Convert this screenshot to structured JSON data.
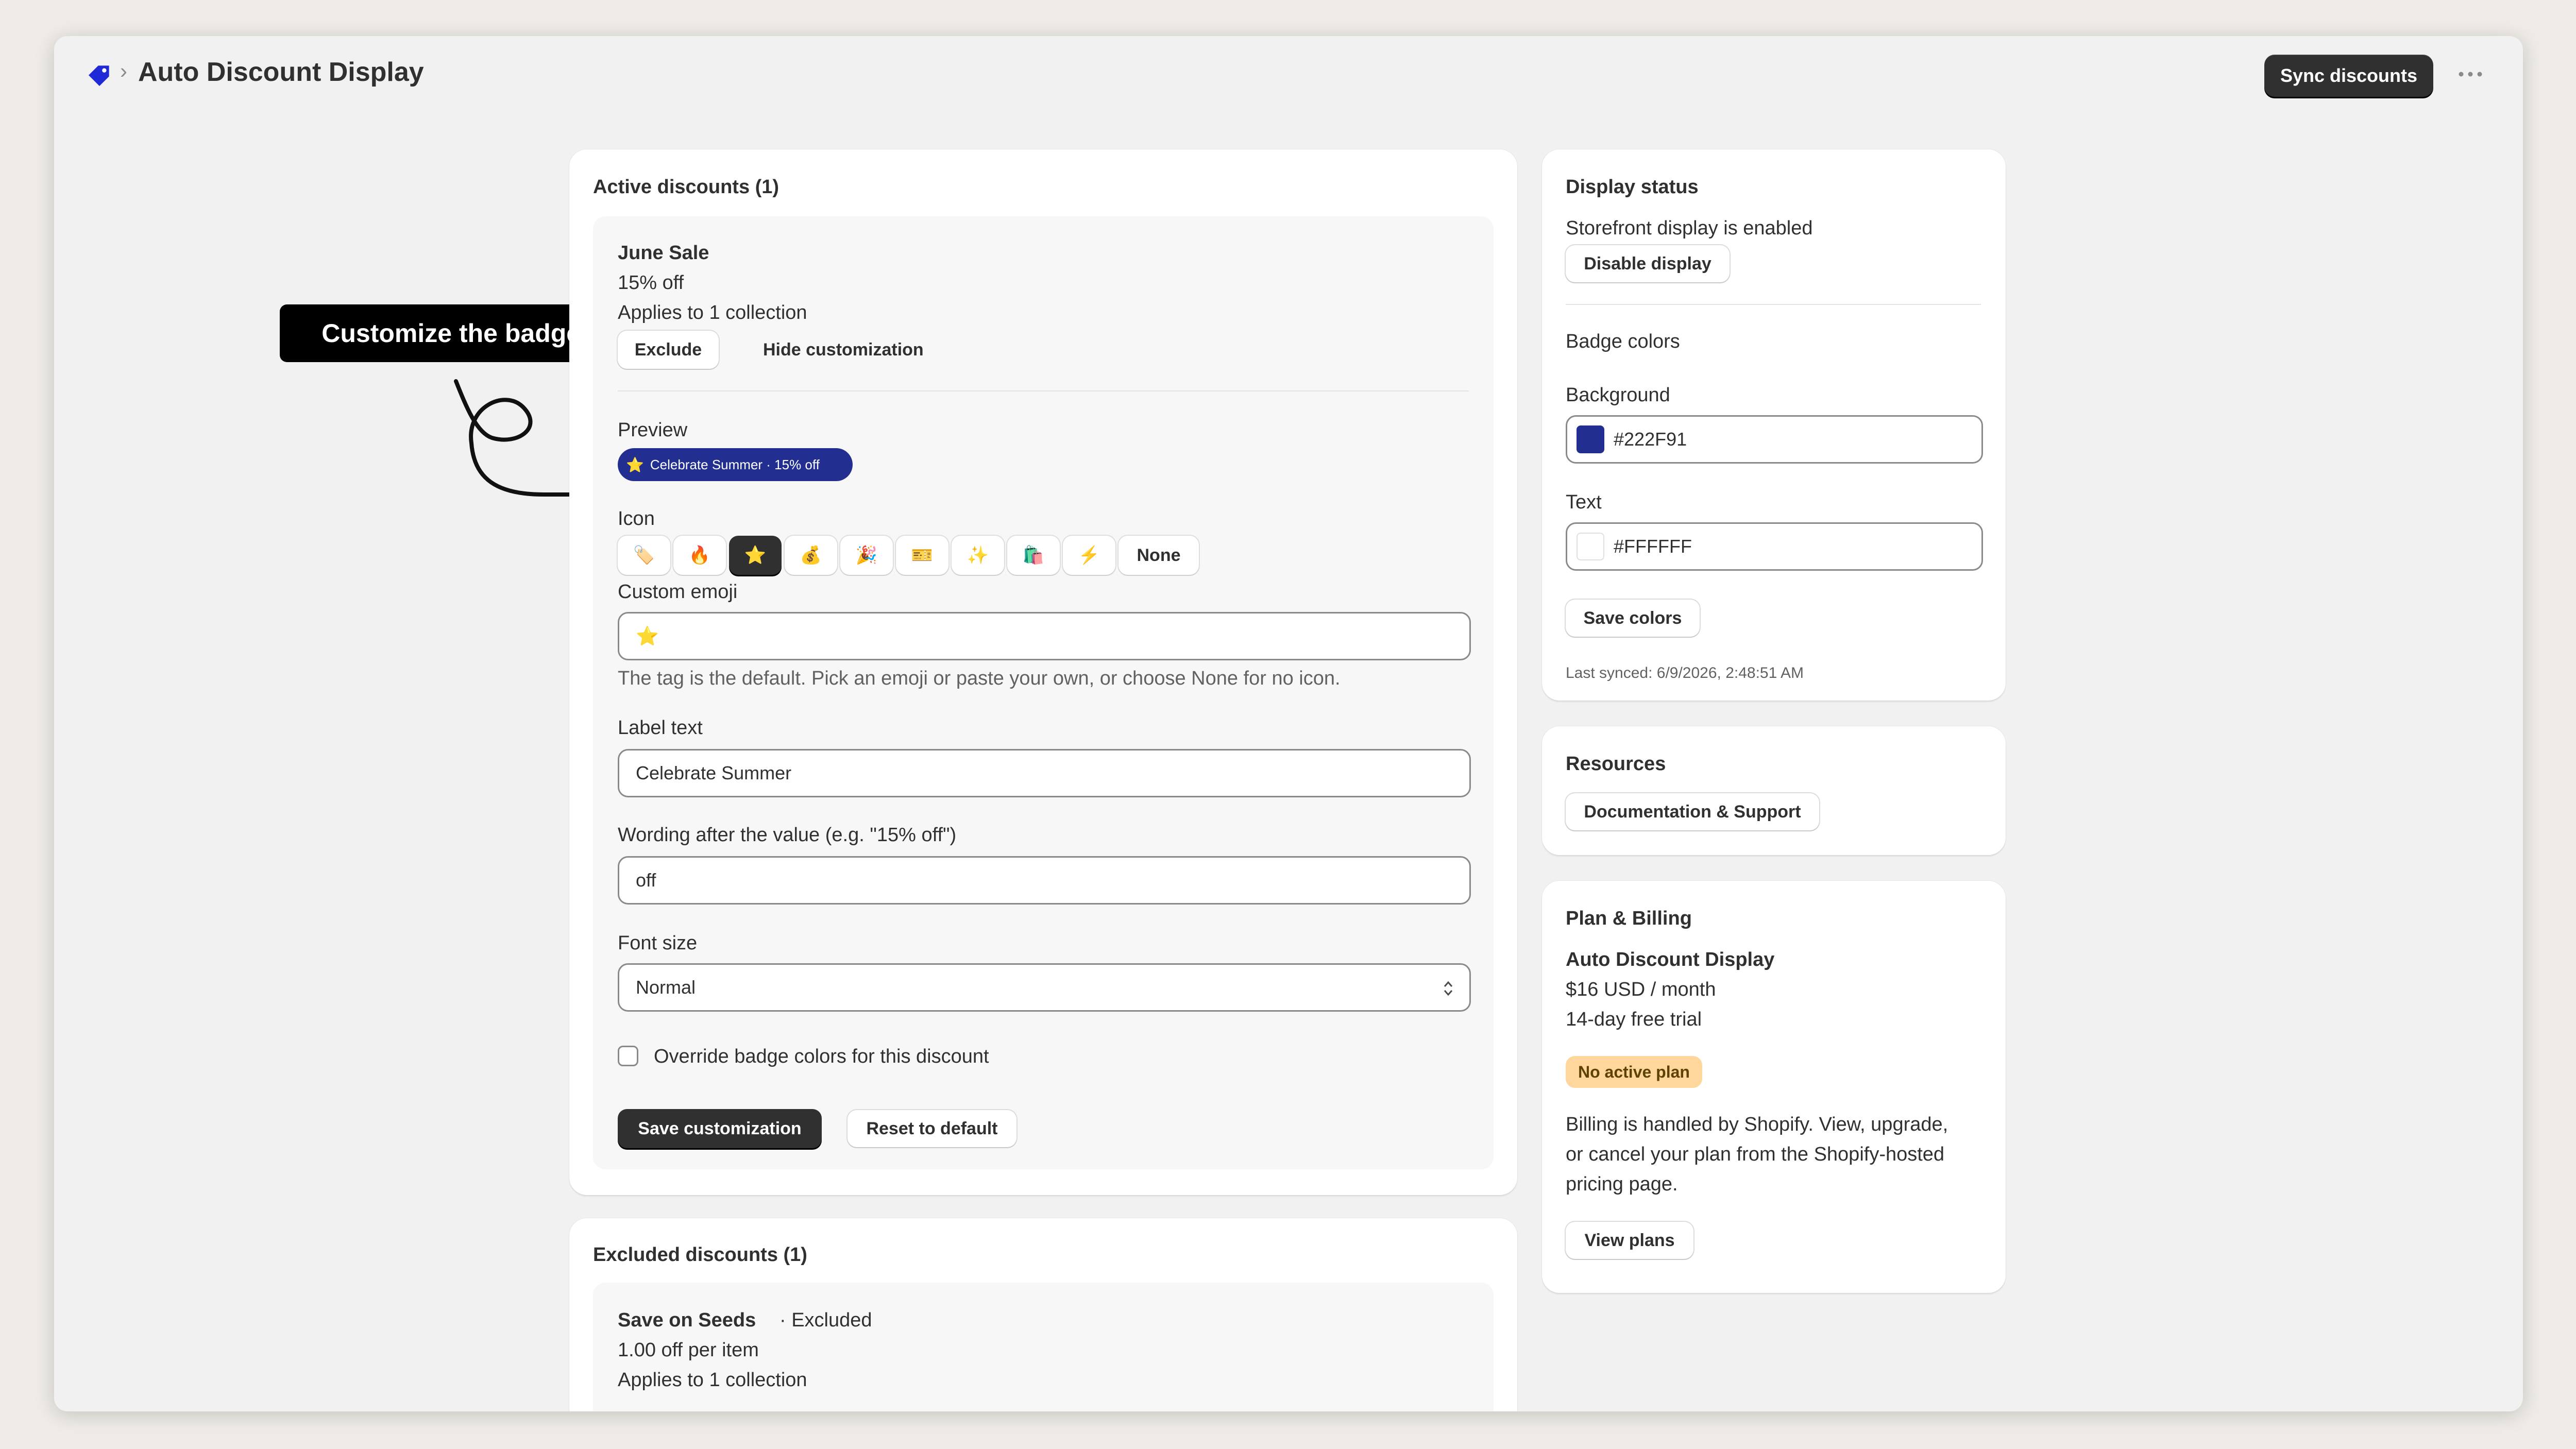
{
  "header": {
    "app_icon": "tag-icon",
    "separator": "›",
    "title": "Auto Discount Display",
    "sync_label": "Sync discounts",
    "more_icon": "ellipsis-icon"
  },
  "callout": {
    "text": "Customize the badge!"
  },
  "active_discounts": {
    "heading": "Active discounts (1)",
    "discount": {
      "name": "June Sale",
      "value": "15% off",
      "applies": "Applies to 1 collection",
      "exclude_label": "Exclude",
      "hide_label": "Hide customization"
    },
    "preview_label": "Preview",
    "preview_badge": {
      "icon": "⭐",
      "text": "Celebrate Summer · 15% off"
    },
    "icon_label": "Icon",
    "icons": [
      "🏷️",
      "🔥",
      "⭐",
      "💰",
      "🎉",
      "🎫",
      "✨",
      "🛍️",
      "⚡"
    ],
    "icons_selected_index": 2,
    "icon_none_label": "None",
    "custom_emoji_label": "Custom emoji",
    "custom_emoji_value": "⭐",
    "custom_emoji_help": "The tag is the default. Pick an emoji or paste your own, or choose None for no icon.",
    "label_text_label": "Label text",
    "label_text_value": "Celebrate Summer",
    "wording_label": "Wording after the value (e.g. \"15% off\")",
    "wording_value": "off",
    "font_size_label": "Font size",
    "font_size_value": "Normal",
    "override_label": "Override badge colors for this discount",
    "override_checked": false,
    "save_label": "Save customization",
    "reset_label": "Reset to default"
  },
  "excluded_discounts": {
    "heading": "Excluded discounts (1)",
    "discount": {
      "name": "Save on Seeds",
      "status": "· Excluded",
      "value": "1.00 off per item",
      "applies": "Applies to 1 collection"
    }
  },
  "display_status": {
    "heading": "Display status",
    "status_text": "Storefront display is enabled",
    "disable_label": "Disable display",
    "badge_colors_heading": "Badge colors",
    "background_label": "Background",
    "background_value": "#222F91",
    "text_label": "Text",
    "text_value": "#FFFFFF",
    "save_colors_label": "Save colors",
    "last_synced": "Last synced: 6/9/2026, 2:48:51 AM"
  },
  "resources": {
    "heading": "Resources",
    "docs_label": "Documentation & Support"
  },
  "billing": {
    "heading": "Plan & Billing",
    "plan_name": "Auto Discount Display",
    "price": "$16 USD / month",
    "trial": "14-day free trial",
    "badge": "No active plan",
    "body_line1": "Billing is handled by Shopify. View, upgrade,",
    "body_line2": "or cancel your plan from the Shopify-hosted",
    "body_line3": "pricing page.",
    "view_plans_label": "View plans"
  },
  "colors": {
    "badge_background": "#222F91",
    "badge_text": "#FFFFFF",
    "plan_badge_bg": "#FFD79D",
    "primary_button": "#303030"
  }
}
